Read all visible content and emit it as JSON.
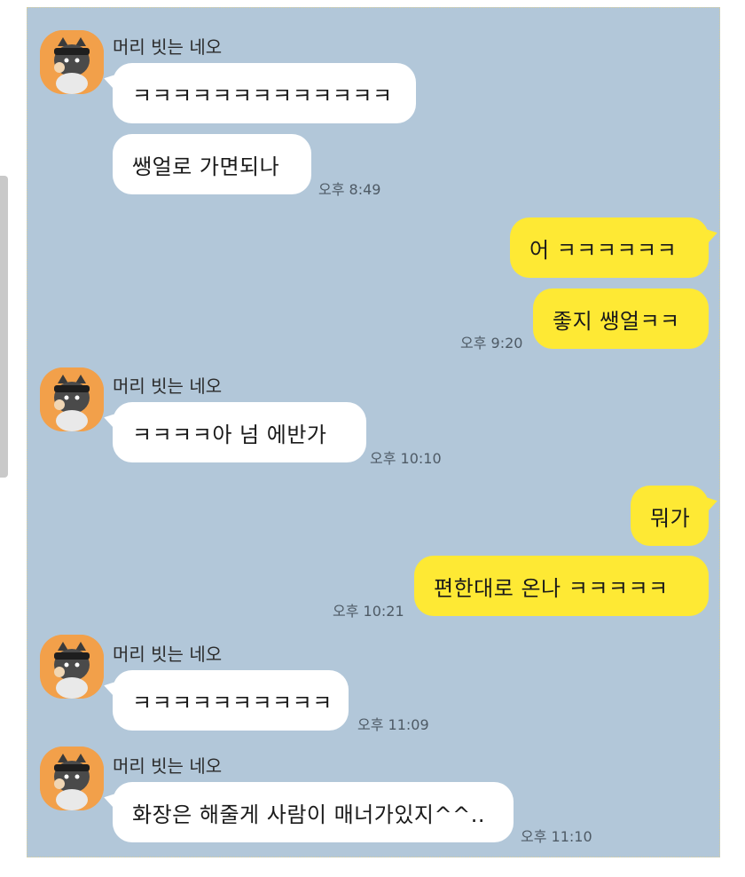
{
  "chat": {
    "sender_name": "머리 빗는 네오",
    "messages": [
      {
        "from": "them",
        "text": "ㅋㅋㅋㅋㅋㅋㅋㅋㅋㅋㅋㅋㅋ"
      },
      {
        "from": "them",
        "text": "쌩얼로 가면되나",
        "time": "오후 8:49"
      },
      {
        "from": "me",
        "text": "어 ㅋㅋㅋㅋㅋㅋ"
      },
      {
        "from": "me",
        "text": "좋지 쌩얼ㅋㅋ",
        "time": "오후 9:20"
      },
      {
        "from": "them",
        "text": "ㅋㅋㅋㅋ아 넘 에반가",
        "time": "오후 10:10"
      },
      {
        "from": "me",
        "text": "뭐가"
      },
      {
        "from": "me",
        "text": "편한대로 온나 ㅋㅋㅋㅋㅋ",
        "time": "오후 10:21"
      },
      {
        "from": "them",
        "text": "ㅋㅋㅋㅋㅋㅋㅋㅋㅋㅋ",
        "time": "오후 11:09"
      },
      {
        "from": "them",
        "text": "화장은 해줄게 사람이 매너가있지^^..",
        "time": "오후 11:10"
      }
    ]
  },
  "colors": {
    "background": "#b2c7d9",
    "incoming_bubble": "#ffffff",
    "outgoing_bubble": "#fee934",
    "avatar": "#f2a04a"
  },
  "icons": {
    "avatar": "neo-character-avatar-icon"
  }
}
